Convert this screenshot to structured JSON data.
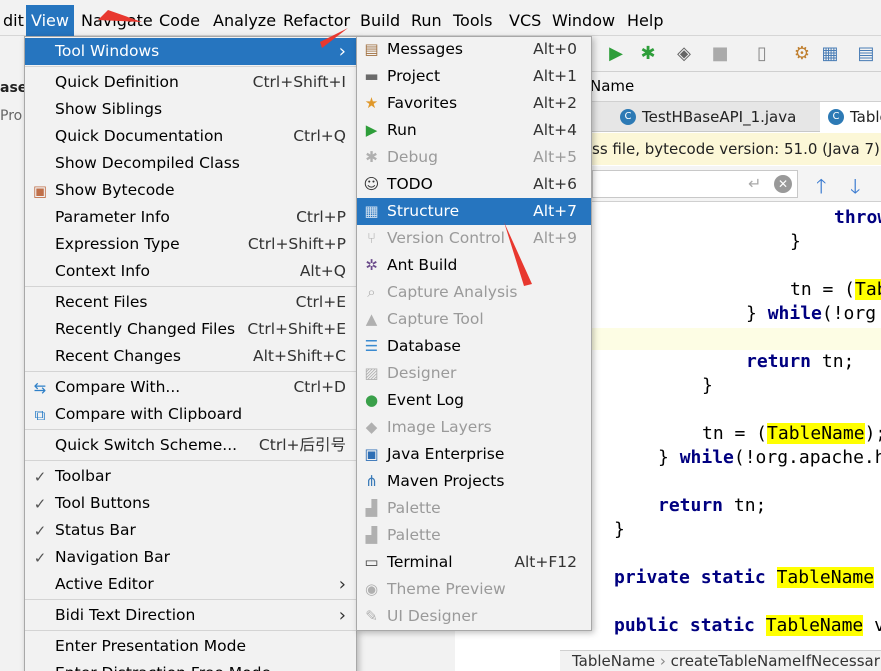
{
  "menubar": {
    "items": [
      {
        "label": "dit"
      },
      {
        "label": "View"
      },
      {
        "label": "Navigate"
      },
      {
        "label": "Code"
      },
      {
        "label": "Analyze"
      },
      {
        "label": "Refactor"
      },
      {
        "label": "Build"
      },
      {
        "label": "Run"
      },
      {
        "label": "Tools"
      },
      {
        "label": "VCS"
      },
      {
        "label": "Window"
      },
      {
        "label": "Help"
      }
    ]
  },
  "left": {
    "tab1": "ase",
    "tab2": "Pro"
  },
  "breadcrumb": {
    "name": "Name"
  },
  "tabs": [
    {
      "label": "TestHBaseAPI_1.java"
    },
    {
      "label": "Table"
    }
  ],
  "notice": "ss file, bytecode version: 51.0 (Java 7)",
  "code": {
    "l1": "throw",
    "l2": "}",
    "l3a": "tn = (",
    "l3b": "Tab",
    "l4a": "} ",
    "l4b": "while",
    "l4c": "(!org",
    "l5a": "return",
    " l5b": " tn;",
    "l6": "}",
    "l7a": "tn = (",
    "l7b": "TableName",
    "l7c": ");",
    "l8a": "} ",
    "l8b": "while",
    "l8c": "(!org.apache.h",
    "l9a": "return",
    "l9b": " tn;",
    "l10": "}",
    "l11a": "private static ",
    "l11b": "TableName",
    "l12a": "public static ",
    "l12b": "TableName",
    "l12c": " v"
  },
  "status": {
    "left": "TableName",
    "sep": "›",
    "right": "createTableNameIfNecessar"
  },
  "viewmenu": {
    "items": [
      {
        "label": "Tool Windows",
        "shortcut": "",
        "arrow": "›"
      },
      {
        "label": "Quick Definition",
        "shortcut": "Ctrl+Shift+I"
      },
      {
        "label": "Show Siblings",
        "shortcut": ""
      },
      {
        "label": "Quick Documentation",
        "shortcut": "Ctrl+Q"
      },
      {
        "label": "Show Decompiled Class",
        "shortcut": ""
      },
      {
        "label": "Show Bytecode",
        "shortcut": ""
      },
      {
        "label": "Parameter Info",
        "shortcut": "Ctrl+P"
      },
      {
        "label": "Expression Type",
        "shortcut": "Ctrl+Shift+P"
      },
      {
        "label": "Context Info",
        "shortcut": "Alt+Q"
      },
      {
        "label": "Recent Files",
        "shortcut": "Ctrl+E"
      },
      {
        "label": "Recently Changed Files",
        "shortcut": "Ctrl+Shift+E"
      },
      {
        "label": "Recent Changes",
        "shortcut": "Alt+Shift+C"
      },
      {
        "label": "Compare With...",
        "shortcut": "Ctrl+D"
      },
      {
        "label": "Compare with Clipboard",
        "shortcut": ""
      },
      {
        "label": "Quick Switch Scheme...",
        "shortcut": "Ctrl+后引号"
      },
      {
        "label": "Toolbar",
        "shortcut": "",
        "check": "✓"
      },
      {
        "label": "Tool Buttons",
        "shortcut": "",
        "check": "✓"
      },
      {
        "label": "Status Bar",
        "shortcut": "",
        "check": "✓"
      },
      {
        "label": "Navigation Bar",
        "shortcut": "",
        "check": "✓"
      },
      {
        "label": "Active Editor",
        "shortcut": "",
        "arrow": "›"
      },
      {
        "label": "Bidi Text Direction",
        "shortcut": "",
        "arrow": "›"
      },
      {
        "label": "Enter Presentation Mode",
        "shortcut": ""
      },
      {
        "label": "Enter Distraction Free Mode",
        "shortcut": ""
      }
    ]
  },
  "submenu": {
    "items": [
      {
        "label": "Messages",
        "shortcut": "Alt+0"
      },
      {
        "label": "Project",
        "shortcut": "Alt+1"
      },
      {
        "label": "Favorites",
        "shortcut": "Alt+2"
      },
      {
        "label": "Run",
        "shortcut": "Alt+4"
      },
      {
        "label": "Debug",
        "shortcut": "Alt+5"
      },
      {
        "label": "TODO",
        "shortcut": "Alt+6"
      },
      {
        "label": "Structure",
        "shortcut": "Alt+7"
      },
      {
        "label": "Version Control",
        "shortcut": "Alt+9"
      },
      {
        "label": "Ant Build",
        "shortcut": ""
      },
      {
        "label": "Capture Analysis",
        "shortcut": ""
      },
      {
        "label": "Capture Tool",
        "shortcut": ""
      },
      {
        "label": "Database",
        "shortcut": ""
      },
      {
        "label": "Designer",
        "shortcut": ""
      },
      {
        "label": "Event Log",
        "shortcut": ""
      },
      {
        "label": "Image Layers",
        "shortcut": ""
      },
      {
        "label": "Java Enterprise",
        "shortcut": ""
      },
      {
        "label": "Maven Projects",
        "shortcut": ""
      },
      {
        "label": "Palette",
        "shortcut": ""
      },
      {
        "label": "Palette",
        "shortcut": ""
      },
      {
        "label": "Terminal",
        "shortcut": "Alt+F12"
      },
      {
        "label": "Theme Preview",
        "shortcut": ""
      },
      {
        "label": "UI Designer",
        "shortcut": ""
      }
    ]
  }
}
